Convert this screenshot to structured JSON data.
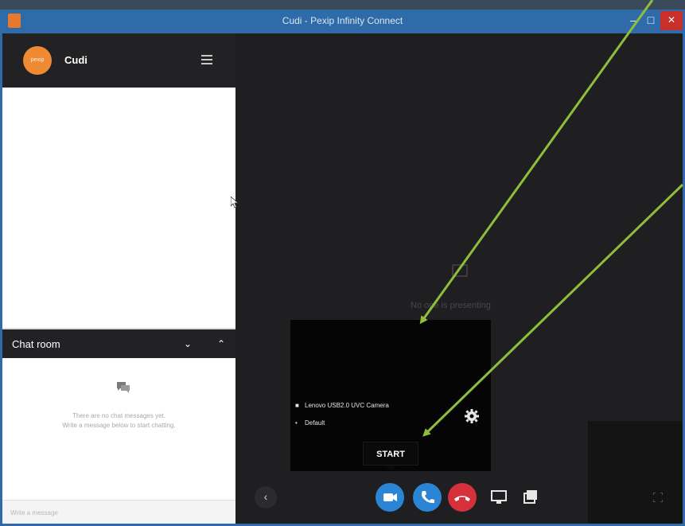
{
  "window": {
    "title": "Cudi - Pexip Infinity Connect",
    "minimize_icon": "minimize-icon",
    "maximize_icon": "maximize-icon",
    "close_icon": "close-icon"
  },
  "sidebar": {
    "avatar_text": "pexip",
    "user_name": "Cudi",
    "menu_icon": "hamburger-icon"
  },
  "chat": {
    "title": "Chat room",
    "empty_line1": "There are no chat messages yet.",
    "empty_line2": "Write a message below to start chatting.",
    "input_placeholder": "Write a message"
  },
  "stage": {
    "presenting_text": "No one is presenting"
  },
  "self_view": {
    "camera_label": "Lenovo  USB2.0  UVC  Camera",
    "mic_label": "Default",
    "start_label": "START"
  },
  "toolbar": {
    "buttons": [
      "previous",
      "video",
      "call",
      "hangup",
      "screen-share",
      "presentation"
    ]
  },
  "colors": {
    "titlebar": "#2e6ba8",
    "accent_blue": "#2a85d4",
    "hangup_red": "#d6303a",
    "avatar_orange": "#f08a32",
    "arrow_green": "#8fbe3d"
  }
}
